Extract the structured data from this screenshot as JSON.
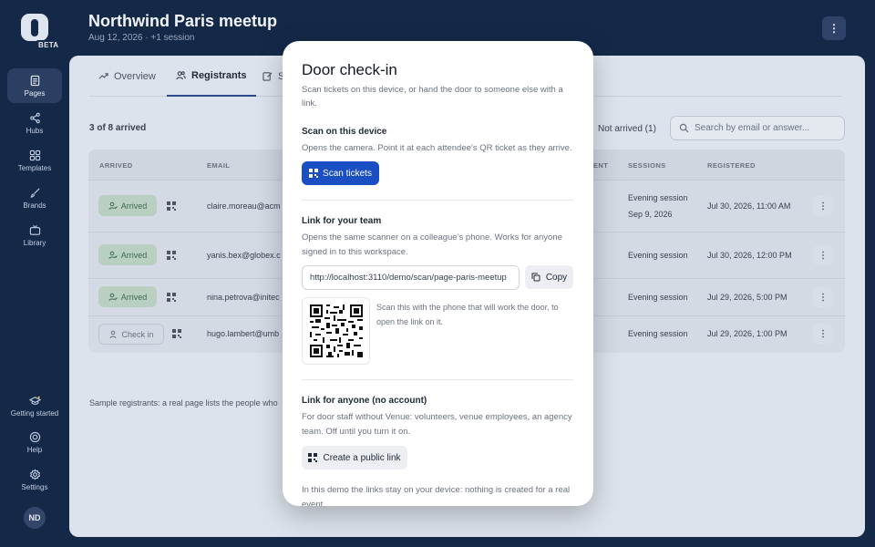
{
  "app": {
    "beta_label": "BETA"
  },
  "nav": {
    "items": [
      {
        "label": "Pages",
        "icon": "pages-icon"
      },
      {
        "label": "Hubs",
        "icon": "share-icon"
      },
      {
        "label": "Templates",
        "icon": "grid-icon"
      },
      {
        "label": "Brands",
        "icon": "brush-icon"
      },
      {
        "label": "Library",
        "icon": "tv-icon"
      }
    ],
    "bottom": [
      {
        "label": "Getting started",
        "icon": "graduation-icon"
      },
      {
        "label": "Help",
        "icon": "help-icon"
      },
      {
        "label": "Settings",
        "icon": "gear-icon"
      }
    ],
    "avatar_initials": "ND"
  },
  "header": {
    "title": "Northwind Paris meetup",
    "subtitle": "Aug 12, 2026 · +1 session",
    "menu_label": "⋮"
  },
  "tabs": [
    {
      "label": "Overview",
      "icon": "trend-icon"
    },
    {
      "label": "Registrants",
      "icon": "users-icon"
    },
    {
      "label": "S",
      "icon": "edit-icon"
    }
  ],
  "registrants": {
    "count_text": "3 of 8 arrived",
    "filter_label": "Not arrived (1)",
    "search_placeholder": "Search by email or answer...",
    "columns": {
      "arrived": "ARRIVED",
      "email": "EMAIL",
      "ent": "ENT",
      "sessions": "SESSIONS",
      "registered": "REGISTERED"
    },
    "rows": [
      {
        "status": "Arrived",
        "email": "claire.moreau@acm",
        "sessions": [
          "Evening session",
          "Sep 9, 2026"
        ],
        "registered": "Jul 30, 2026, 11:00 AM"
      },
      {
        "status": "Arrived",
        "email": "yanis.bex@globex.c",
        "sessions": [
          "Evening session"
        ],
        "registered": "Jul 30, 2026, 12:00 PM"
      },
      {
        "status": "Arrived",
        "email": "nina.petrova@initec",
        "sessions": [
          "Evening session"
        ],
        "registered": "Jul 29, 2026, 5:00 PM"
      },
      {
        "status": "Check in",
        "email": "hugo.lambert@umb",
        "sessions": [
          "Evening session"
        ],
        "registered": "Jul 29, 2026, 1:00 PM"
      }
    ],
    "footnote": "Sample registrants: a real page lists the people who"
  },
  "modal": {
    "title": "Door check-in",
    "intro": "Scan tickets on this device, or hand the door to someone else with a link.",
    "device": {
      "heading": "Scan on this device",
      "text": "Opens the camera. Point it at each attendee’s QR ticket as they arrive.",
      "button": "Scan tickets"
    },
    "team": {
      "heading": "Link for your team",
      "text": "Opens the same scanner on a colleague’s phone. Works for anyone signed in to this workspace.",
      "url": "http://localhost:3110/demo/scan/page-paris-meetup",
      "copy_label": "Copy",
      "qr_caption": "Scan this with the phone that will work the door, to open the link on it."
    },
    "public": {
      "heading": "Link for anyone (no account)",
      "text": "For door staff without Venue: volunteers, venue employees, an agency team. Off until you turn it on.",
      "button": "Create a public link"
    },
    "demo_note": "In this demo the links stay on your device: nothing is created for a real event."
  },
  "colors": {
    "accent": "#1a4fc4",
    "rail": "#142848",
    "arrived_badge": "#b9cfc1"
  }
}
